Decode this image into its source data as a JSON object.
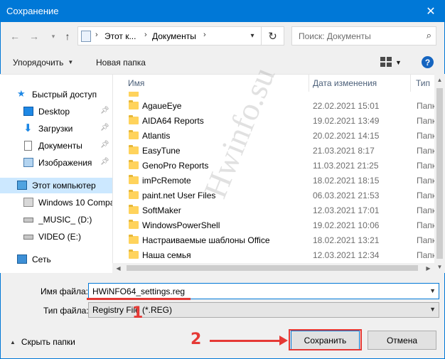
{
  "window": {
    "title": "Сохранение",
    "close_glyph": "✕"
  },
  "address": {
    "crumbs": [
      "Этот к...",
      "Документы"
    ],
    "search_placeholder": "Поиск: Документы"
  },
  "toolbar": {
    "organize_label": "Упорядочить",
    "new_folder_label": "Новая папка"
  },
  "nav": {
    "items": [
      {
        "label": "Быстрый доступ",
        "icon": "star-icon"
      },
      {
        "label": "Desktop",
        "icon": "desktop-icon",
        "pinned": true
      },
      {
        "label": "Загрузки",
        "icon": "download-icon",
        "pinned": true
      },
      {
        "label": "Документы",
        "icon": "document-icon",
        "pinned": true
      },
      {
        "label": "Изображения",
        "icon": "pictures-icon",
        "pinned": true
      },
      {
        "label": "Этот компьютер",
        "icon": "computer-icon",
        "selected": true
      },
      {
        "label": "Windows 10 Compa",
        "icon": "windows-drive-icon"
      },
      {
        "label": "_MUSIC_ (D:)",
        "icon": "drive-icon"
      },
      {
        "label": "VIDEO (E:)",
        "icon": "drive-icon"
      },
      {
        "label": "Сеть",
        "icon": "network-icon"
      }
    ]
  },
  "list": {
    "columns": {
      "name": "Имя",
      "date": "Дата изменения",
      "type": "Тип"
    },
    "rows": [
      {
        "name": "AgaueEye",
        "date": "22.02.2021 15:01",
        "type": "Папк"
      },
      {
        "name": "AIDA64 Reports",
        "date": "19.02.2021 13:49",
        "type": "Папк"
      },
      {
        "name": "Atlantis",
        "date": "20.02.2021 14:15",
        "type": "Папк"
      },
      {
        "name": "EasyTune",
        "date": "21.03.2021 8:17",
        "type": "Папк"
      },
      {
        "name": "GenoPro Reports",
        "date": "11.03.2021 21:25",
        "type": "Папк"
      },
      {
        "name": "imPcRemote",
        "date": "18.02.2021 18:15",
        "type": "Папк"
      },
      {
        "name": "paint.net User Files",
        "date": "06.03.2021 21:53",
        "type": "Папк"
      },
      {
        "name": "SoftMaker",
        "date": "12.03.2021 17:01",
        "type": "Папк"
      },
      {
        "name": "WindowsPowerShell",
        "date": "19.02.2021 10:06",
        "type": "Папк"
      },
      {
        "name": "Настраиваемые шаблоны Office",
        "date": "18.02.2021 13:21",
        "type": "Папк"
      },
      {
        "name": "Наша семья",
        "date": "12.03.2021 12:34",
        "type": "Папк"
      }
    ]
  },
  "filename": {
    "label": "Имя файла:",
    "value": "HWiNFO64_settings.reg"
  },
  "filetype": {
    "label": "Тип файла:",
    "value": "Registry File (*.REG)"
  },
  "bottom": {
    "hide_folders": "Скрыть папки",
    "save": "Сохранить",
    "cancel": "Отмена"
  },
  "annotations": {
    "step1": "1",
    "step2": "2",
    "watermark": "Hwinfo.su"
  },
  "colors": {
    "accent": "#0078d7",
    "annotation": "#e53935",
    "folder": "#ffd35c"
  }
}
